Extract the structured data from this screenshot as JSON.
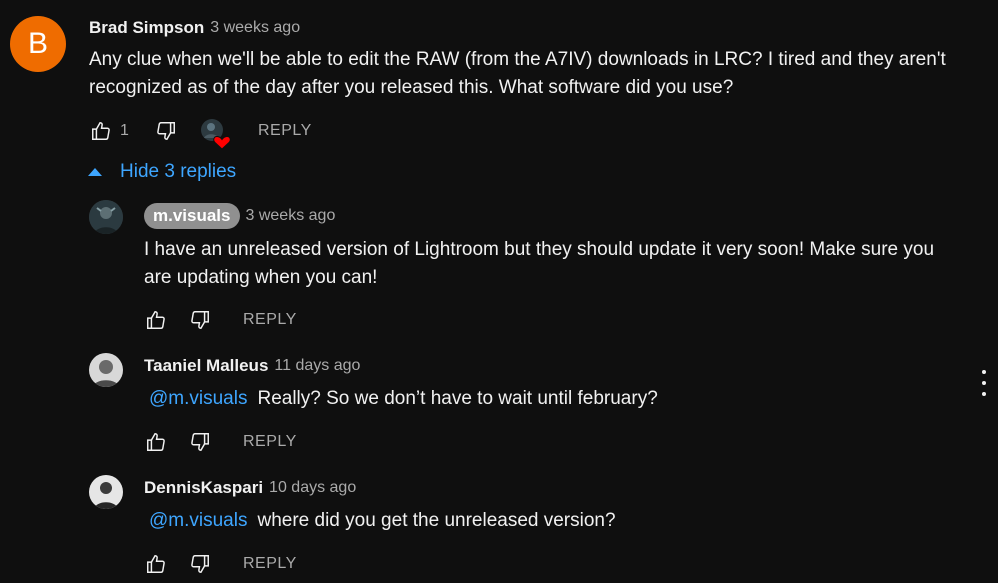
{
  "comment": {
    "avatar_letter": "B",
    "author": "Brad Simpson",
    "time": "3 weeks ago",
    "text_line1": "Any clue when we'll be able to edit the RAW (from the A7IV) downloads in LRC?  I tired and they aren't",
    "text_line2": "recognized as of the day after you released this.  What software did you use?",
    "likes": "1",
    "reply_label": "REPLY",
    "hide_replies_label": "Hide 3 replies"
  },
  "replies": [
    {
      "author": "m.visuals",
      "time": "3 weeks ago",
      "text_line1": "I have an unreleased version of Lightroom but they should update it very soon! Make sure you",
      "text_line2": "are updating when you can!",
      "reply_label": "REPLY"
    },
    {
      "author": "Taaniel Malleus",
      "time": "11 days ago",
      "mention": "@m.visuals",
      "text": "Really? So we don’t have to wait until february?",
      "reply_label": "REPLY"
    },
    {
      "author": "DennisKaspari",
      "time": "10 days ago",
      "mention": "@m.visuals",
      "text": "where did you get the unreleased version?",
      "reply_label": "REPLY"
    }
  ],
  "colors": {
    "background": "#0f0f0f",
    "link": "#3ea6ff",
    "avatar_orange": "#ef6c00",
    "heart": "#ff0000"
  },
  "icons": [
    "thumbs-up-icon",
    "thumbs-down-icon",
    "heart-icon",
    "more-vert-icon",
    "caret-up-icon"
  ]
}
